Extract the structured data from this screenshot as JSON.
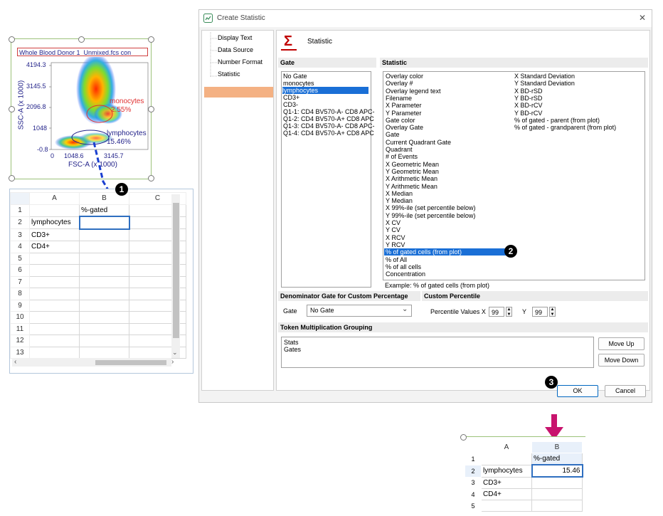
{
  "plot": {
    "title": "Whole Blood Donor 1_Unmixed.fcs con",
    "y_ticks": [
      "4194.3",
      "3145.5",
      "2096.8",
      "1048",
      "-0.8"
    ],
    "x_ticks": [
      "0",
      "1048.6",
      "3145.7"
    ],
    "y_label": "SSC-A (x 1000)",
    "x_label": "FSC-A (x 1000)",
    "gates": [
      {
        "name": "monocytes",
        "percent": "2.55%"
      },
      {
        "name": "lymphocytes",
        "percent": "15.46%"
      }
    ]
  },
  "sheet": {
    "columns": [
      "A",
      "B",
      "C"
    ],
    "rows": [
      {
        "num": "1",
        "a": "",
        "b": "%-gated"
      },
      {
        "num": "2",
        "a": "lymphocytes",
        "b": ""
      },
      {
        "num": "3",
        "a": "CD3+",
        "b": ""
      },
      {
        "num": "4",
        "a": "CD4+",
        "b": ""
      },
      {
        "num": "5",
        "a": "",
        "b": ""
      },
      {
        "num": "6",
        "a": "",
        "b": ""
      },
      {
        "num": "7",
        "a": "",
        "b": ""
      },
      {
        "num": "8",
        "a": "",
        "b": ""
      },
      {
        "num": "9",
        "a": "",
        "b": ""
      },
      {
        "num": "10",
        "a": "",
        "b": ""
      },
      {
        "num": "11",
        "a": "",
        "b": ""
      },
      {
        "num": "12",
        "a": "",
        "b": ""
      },
      {
        "num": "13",
        "a": "",
        "b": ""
      }
    ]
  },
  "badges": {
    "one": "1",
    "two": "2",
    "three": "3"
  },
  "dialog": {
    "title": "Create Statistic",
    "close": "✕",
    "nav": [
      "Display Text",
      "Data Source",
      "Number Format",
      "Statistic"
    ],
    "header_symbol": "Σ",
    "header_title": "Statistic",
    "gate_header": "Gate",
    "gates": [
      "No Gate",
      "monocytes",
      "lymphocytes",
      "CD3+",
      "CD3-",
      "Q1-1: CD4 BV570-A- CD8 APC-",
      "Q1-2: CD4 BV570-A+ CD8 APC",
      "Q1-3: CD4 BV570-A- CD8 APC-",
      "Q1-4: CD4 BV570-A+ CD8 APC"
    ],
    "stat_header": "Statistic",
    "stats_col1": [
      "Overlay color",
      "Overlay #",
      "Overlay legend text",
      "Filename",
      "X Parameter",
      "Y Parameter",
      "Gate color",
      "Overlay Gate",
      "Gate",
      "Current Quadrant Gate",
      "Quadrant",
      "# of Events",
      "X Geometric Mean",
      "Y Geometric Mean",
      "X Arithmetic Mean",
      "Y Arithmetic Mean",
      "X Median",
      "Y Median",
      "X 99%-ile (set percentile below)",
      "Y 99%-ile (set percentile below)",
      "X CV",
      "Y CV",
      "X RCV",
      "Y RCV",
      "% of gated cells (from plot)",
      "% of All",
      "% of all cells",
      "Concentration"
    ],
    "stats_col2": [
      "X Standard Deviation",
      "Y Standard Deviation",
      "X BD-rSD",
      "Y BD-rSD",
      "X BD-rCV",
      "Y BD-rCV",
      "% of gated - parent (from plot)",
      "% of gated - grandparent (from plot)"
    ],
    "example": "Example: % of gated cells (from plot)",
    "denom_header": "Denominator Gate for Custom Percentage",
    "denom_label": "Gate",
    "denom_value": "No Gate",
    "custom_header": "Custom Percentile",
    "percentile_label": "Percentile Values X",
    "px": "99",
    "y_label": "Y",
    "py": "99",
    "token_header": "Token Multiplication Grouping",
    "tokens": [
      "Stats",
      "Gates"
    ],
    "move_up": "Move Up",
    "move_down": "Move Down",
    "ok": "OK",
    "cancel": "Cancel"
  },
  "sheet2": {
    "columns": [
      "A",
      "B"
    ],
    "rows": [
      {
        "num": "1",
        "a": "",
        "b": "%-gated"
      },
      {
        "num": "2",
        "a": "lymphocytes",
        "b": "15.46"
      },
      {
        "num": "3",
        "a": "CD3+",
        "b": ""
      },
      {
        "num": "4",
        "a": "CD4+",
        "b": ""
      },
      {
        "num": "5",
        "a": "",
        "b": ""
      }
    ]
  },
  "colors": {
    "accent": "#1a6fd6",
    "nav_selected": "#f4b183",
    "arrow": "#c8136d",
    "gate_mono": "#e03030",
    "gate_lymph": "#23238a"
  }
}
